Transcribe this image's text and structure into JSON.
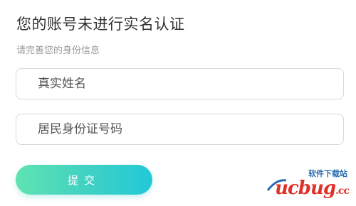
{
  "header": {
    "title": "您的账号未进行实名认证",
    "subtitle": "请完善您的身份信息"
  },
  "form": {
    "name_placeholder": "真实姓名",
    "id_placeholder": "居民身份证号码",
    "submit_label": "提交"
  },
  "watermark": {
    "top_text": "软件下载站",
    "main_text": "ucbug",
    "suffix": ".cc"
  },
  "colors": {
    "button_gradient_start": "#5fe3b1",
    "button_gradient_end": "#21c9d8",
    "title": "#333333",
    "subtitle": "#9a9a9a",
    "border": "#d9d9d9"
  }
}
